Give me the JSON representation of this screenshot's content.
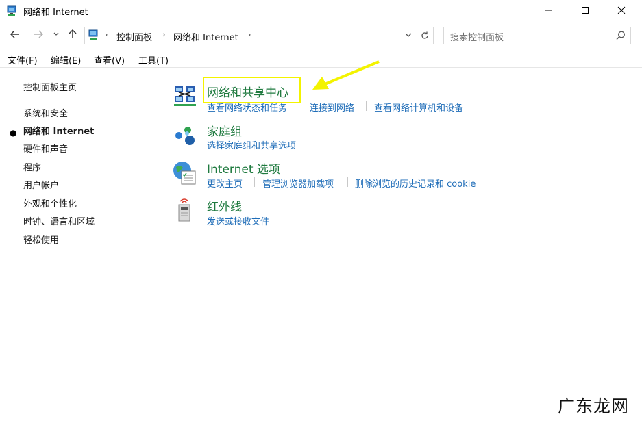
{
  "window": {
    "title": "网络和 Internet",
    "icon": "network-internet-icon"
  },
  "nav": {
    "breadcrumbs": [
      "控制面板",
      "网络和 Internet"
    ],
    "search_placeholder": "搜索控制面板"
  },
  "menu": [
    "文件(F)",
    "编辑(E)",
    "查看(V)",
    "工具(T)"
  ],
  "sidebar": {
    "home": "控制面板主页",
    "items": [
      {
        "label": "系统和安全",
        "active": false
      },
      {
        "label": "网络和 Internet",
        "active": true
      },
      {
        "label": "硬件和声音",
        "active": false
      },
      {
        "label": "程序",
        "active": false
      },
      {
        "label": "用户帐户",
        "active": false
      },
      {
        "label": "外观和个性化",
        "active": false
      },
      {
        "label": "时钟、语言和区域",
        "active": false
      },
      {
        "label": "轻松使用",
        "active": false
      }
    ]
  },
  "categories": [
    {
      "title": "网络和共享中心",
      "icon": "network-sharing-center-icon",
      "links": [
        "查看网络状态和任务",
        "连接到网络",
        "查看网络计算机和设备"
      ]
    },
    {
      "title": "家庭组",
      "icon": "homegroup-icon",
      "links": [
        "选择家庭组和共享选项"
      ]
    },
    {
      "title": "Internet 选项",
      "icon": "internet-options-icon",
      "links": [
        "更改主页",
        "管理浏览器加载项",
        "删除浏览的历史记录和 cookie"
      ]
    },
    {
      "title": "红外线",
      "icon": "infrared-icon",
      "links": [
        "发送或接收文件"
      ]
    }
  ],
  "colors": {
    "category_title": "#1f7a3f",
    "link": "#1f6db8",
    "highlight": "#f3f300"
  },
  "watermark": "广东龙网"
}
